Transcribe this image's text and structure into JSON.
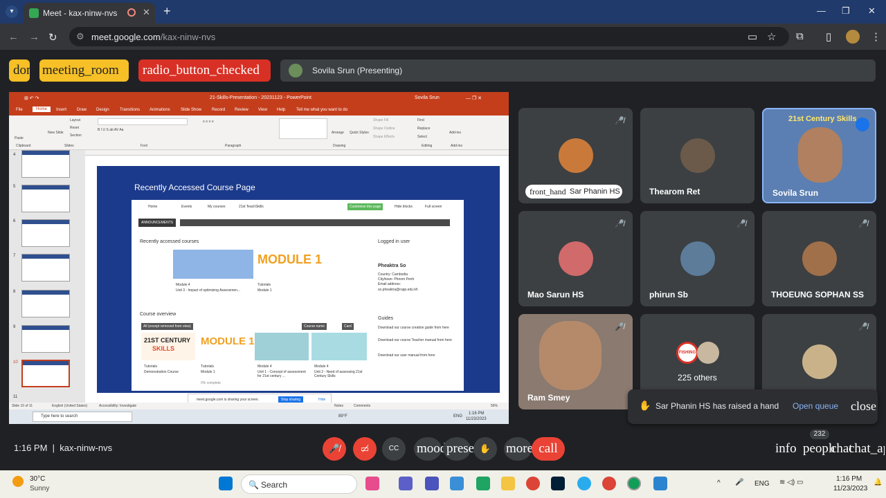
{
  "browser": {
    "tab_title": "Meet - kax-ninw-nvs",
    "url_host": "meet.google.com",
    "url_path": "/kax-ninw-nvs"
  },
  "meet_header": {
    "pill1": "domain_disabled",
    "pill2": "meeting_room",
    "pill3": "radio_button_checked",
    "presenter": "Sovila Srun (Presenting)"
  },
  "presentation": {
    "window_title": "21-Skills-Presentation - 20231123 - PowerPoint",
    "user": "Sovila Srun",
    "ribbon_tabs": [
      "File",
      "Home",
      "Insert",
      "Draw",
      "Design",
      "Transitions",
      "Animations",
      "Slide Show",
      "Record",
      "Review",
      "View",
      "Help"
    ],
    "tell_me": "Tell me what you want to do",
    "ribbon_groups": [
      "Clipboard",
      "Slides",
      "Font",
      "Paragraph",
      "Drawing",
      "Editing",
      "Add-ins"
    ],
    "ribbon_items": {
      "paste": "Paste",
      "new_slide": "New Slide",
      "layout": "Layout",
      "reset": "Reset",
      "section": "Section",
      "arrange": "Arrange",
      "quick_styles": "Quick Styles",
      "shape_fill": "Shape Fill",
      "shape_outline": "Shape Outline",
      "shape_effects": "Shape Effects",
      "find": "Find",
      "replace": "Replace",
      "select": "Select",
      "add_ins": "Add-ins"
    },
    "slide_numbers": [
      "4",
      "5",
      "6",
      "7",
      "8",
      "9",
      "10",
      "11"
    ],
    "slide_heading": "Recently Accessed Course Page",
    "moodle": {
      "nav_items": [
        "Home",
        "Events",
        "My courses",
        "21st TeachSkills"
      ],
      "customise": "Customise this page",
      "hide_blocks": "Hide blocks",
      "full_screen": "Full screen",
      "announcements": "ANNOUNCEMENTS",
      "recent_title": "Recently accessed courses",
      "module_badge": "MODULE 1",
      "card1_cat": "Module 4",
      "card1_name": "Unit 3 - Impact of optimizing Assessmen...",
      "card2_cat": "Tutorials",
      "card2_name": "Module 1",
      "logged_in_title": "Logged in user",
      "user_name": "Pheaktra So",
      "country": "Country: Cambodia",
      "city": "City/town: Phnom Penh",
      "email_label": "Email address:",
      "email": "so.pheaktra@rupp.edu.kh",
      "guides_title": "Guides",
      "guide1": "Download our course creation guide from here",
      "guide2": "Download our course Teacher manual from here",
      "guide3": "Download our user manual from here",
      "overview_title": "Course overview",
      "filter": "All (except removed from view)",
      "sort": "Course name",
      "view": "Card",
      "skills_badge_top": "21ST CENTURY",
      "skills_badge_bottom": "SKILLS",
      "ov1_cat": "Tutorials",
      "ov1_name": "Demonstration Course",
      "ov2_cat": "Tutorials",
      "ov2_name": "Module 1",
      "ov2_extra": "0% complete",
      "ov3_cat": "Module 4",
      "ov3_name": "Unit 1 - Concept of assessment for 21st century ...",
      "ov4_cat": "Module 4",
      "ov4_name": "Unit 2 - Need of assessing 21st Century Skills"
    },
    "share_notice": "meet.google.com is sharing your screen.",
    "stop_sharing": "Stop sharing",
    "hide": "Hide",
    "status_slide": "Slide 10 of 11",
    "status_lang": "English (United States)",
    "status_access": "Accessibility: Investigate",
    "status_notes": "Notes",
    "status_comments": "Comments",
    "zoom": "56%",
    "win_search": "Type here to search",
    "win_temp": "89°F",
    "win_lang": "ENG",
    "win_time": "1:16 PM",
    "win_date": "11/23/2023"
  },
  "participants": [
    {
      "name": "Sar Phanin HS",
      "hand_label": "front_hand"
    },
    {
      "name": "Thearom Ret"
    },
    {
      "name": "Sovila Srun",
      "tile_title": "21st Century Skills"
    },
    {
      "name": "Mao Sarun HS"
    },
    {
      "name": "phirun Sb"
    },
    {
      "name": "THOEUNG SOPHAN SS"
    },
    {
      "name": "Ram Smey"
    },
    {
      "name": "225 others",
      "badge": "FISHING"
    }
  ],
  "toast": {
    "message": "Sar Phanin HS has raised a hand",
    "action": "Open queue",
    "close": "close"
  },
  "bottom_bar": {
    "time": "1:16 PM",
    "code": "kax-ninw-nvs",
    "mood": "mood",
    "present": "present_to_all",
    "more": "more_vert",
    "call": "call",
    "info": "info",
    "people": "people",
    "chat": "chat",
    "chat_apps": "chat_apps",
    "people_count": "232"
  },
  "taskbar": {
    "temp": "30°C",
    "condition": "Sunny",
    "search": "Search",
    "lang": "ENG",
    "time": "1:16 PM",
    "date": "11/23/2023"
  },
  "colors": {
    "meet_bg": "#202124",
    "tile_bg": "#3c4043",
    "accent_red": "#ea4335",
    "accent_yellow": "#f6c026",
    "ppt_orange": "#c43e1c",
    "slide_blue": "#1b3a8c"
  }
}
